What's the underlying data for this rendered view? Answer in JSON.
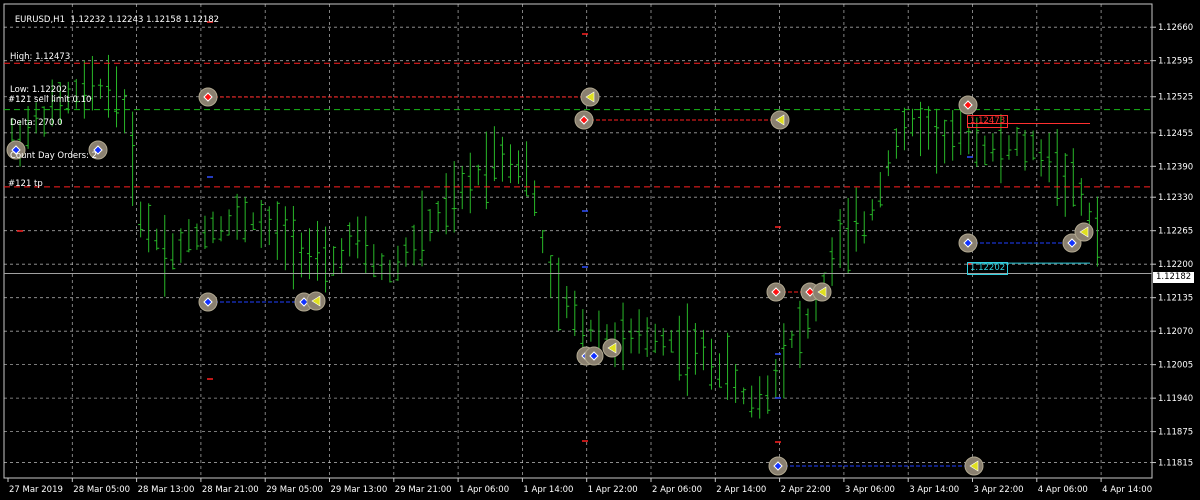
{
  "header": {
    "symbol": "EURUSD,H1",
    "ohlc": "1.12232 1.12243 1.12158 1.12182"
  },
  "stats": {
    "high": "High: 1.12473",
    "low": "Low: 1.12202",
    "delta": "Delta: 270.0",
    "count": "Count Day Orders: 2"
  },
  "levels": {
    "sell_limit_label": "#121 sell limit 0.10",
    "tp_label": "#121 tp",
    "high_tag": "1.12473",
    "low_tag": "1.12202",
    "current_price": "1.12182"
  },
  "colors": {
    "background": "#000000",
    "grid": "#d8d8d8",
    "candle": "#28b828",
    "sell_limit": "#18b818",
    "tp": "#ff2020",
    "high_line": "#ff3030",
    "low_line": "#30d0e0",
    "price_line": "#a0a0a0"
  },
  "chart_data": {
    "type": "candlestick",
    "instrument": "EURUSD",
    "timeframe": "H1",
    "ylim": [
      1.1185,
      1.1265
    ],
    "y_ticks": [
      "1.12660",
      "1.12595",
      "1.12525",
      "1.12455",
      "1.12390",
      "1.12330",
      "1.12265",
      "1.12200",
      "1.12135",
      "1.12070",
      "1.12005",
      "1.11940",
      "1.11875",
      "1.11815"
    ],
    "x_ticks": [
      "27 Mar 2019",
      "28 Mar 05:00",
      "28 Mar 13:00",
      "28 Mar 21:00",
      "29 Mar 05:00",
      "29 Mar 13:00",
      "29 Mar 21:00",
      "1 Apr 06:00",
      "1 Apr 14:00",
      "1 Apr 22:00",
      "2 Apr 06:00",
      "2 Apr 14:00",
      "2 Apr 22:00",
      "3 Apr 06:00",
      "3 Apr 14:00",
      "3 Apr 22:00",
      "4 Apr 06:00",
      "4 Apr 14:00"
    ],
    "grid": true,
    "bars_summary": {
      "first_close": 1.1243,
      "last_close": 1.12182,
      "period_high": 1.1262,
      "period_low": 1.1188
    },
    "horizontal_lines": [
      {
        "name": "#121 sell limit 0.10",
        "value": 1.125,
        "style": "dashed",
        "color": "#18b818"
      },
      {
        "name": "#121 tp",
        "value": 1.1235,
        "style": "dashed",
        "color": "#ff2020"
      },
      {
        "name": "upper red dashed",
        "value": 1.1259,
        "style": "dashed",
        "color": "#ff2020"
      },
      {
        "name": "High",
        "value": 1.12473,
        "style": "solid",
        "color": "#ff3030"
      },
      {
        "name": "Low",
        "value": 1.12202,
        "style": "solid",
        "color": "#30d0e0"
      },
      {
        "name": "current price",
        "value": 1.12182,
        "style": "solid",
        "color": "#a0a0a0"
      }
    ],
    "trade_markers": [
      {
        "x": "27 Mar 2019",
        "price": 1.1242,
        "kind": "buy"
      },
      {
        "x": "28 Mar 05:00",
        "price": 1.1242,
        "kind": "buy"
      },
      {
        "x": "28 Mar 21:00",
        "price": 1.1251,
        "kind": "sell"
      },
      {
        "x": "28 Mar 21:00",
        "price": 1.1213,
        "kind": "buy"
      },
      {
        "x": "29 Mar 05:00",
        "price": 1.1213,
        "kind": "buy"
      },
      {
        "x": "29 Mar 05:00",
        "price": 1.1213,
        "kind": "close"
      },
      {
        "x": "1 Apr 22:00",
        "price": 1.1251,
        "kind": "close"
      },
      {
        "x": "1 Apr 22:00",
        "price": 1.1248,
        "kind": "sell"
      },
      {
        "x": "2 Apr 14:00",
        "price": 1.1248,
        "kind": "close"
      },
      {
        "x": "1 Apr 22:00",
        "price": 1.1204,
        "kind": "buy"
      },
      {
        "x": "1 Apr 22:00",
        "price": 1.1204,
        "kind": "buy"
      },
      {
        "x": "1 Apr 22:00",
        "price": 1.1206,
        "kind": "close"
      },
      {
        "x": "2 Apr 22:00",
        "price": 1.1216,
        "kind": "sell"
      },
      {
        "x": "2 Apr 22:00",
        "price": 1.1216,
        "kind": "sell"
      },
      {
        "x": "2 Apr 22:00",
        "price": 1.1216,
        "kind": "close"
      },
      {
        "x": "2 Apr 22:00",
        "price": 1.1184,
        "kind": "buy"
      },
      {
        "x": "3 Apr 22:00",
        "price": 1.1184,
        "kind": "close"
      },
      {
        "x": "3 Apr 22:00",
        "price": 1.125,
        "kind": "sell"
      },
      {
        "x": "3 Apr 22:00",
        "price": 1.1225,
        "kind": "buy"
      },
      {
        "x": "4 Apr 06:00",
        "price": 1.1225,
        "kind": "buy"
      },
      {
        "x": "4 Apr 14:00",
        "price": 1.1226,
        "kind": "close"
      }
    ]
  }
}
